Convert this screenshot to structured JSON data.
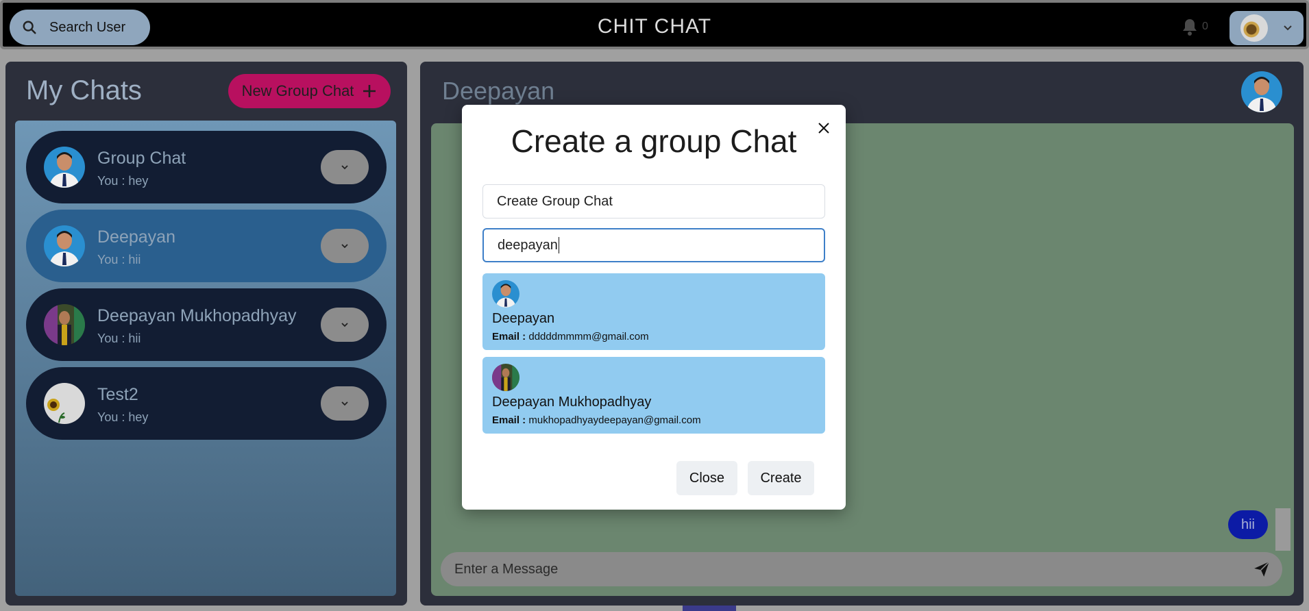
{
  "topbar": {
    "search_label": "Search User",
    "app_title": "CHIT CHAT",
    "notification_count": "0"
  },
  "sidebar": {
    "title": "My Chats",
    "new_group_label": "New Group Chat",
    "chats": [
      {
        "name": "Group Chat",
        "last_message": "You : hey",
        "active": false
      },
      {
        "name": "Deepayan",
        "last_message": "You : hii",
        "active": true
      },
      {
        "name": "Deepayan Mukhopadhyay",
        "last_message": "You : hii",
        "active": false
      },
      {
        "name": "Test2",
        "last_message": "You : hey",
        "active": false
      }
    ]
  },
  "chat": {
    "title": "Deepayan",
    "messages": [
      {
        "text": "hii",
        "from": "me"
      }
    ],
    "input_placeholder": "Enter a Message"
  },
  "modal": {
    "title": "Create a group Chat",
    "group_name_value": "Create Group Chat",
    "search_value": "deepayan",
    "results": [
      {
        "name": "Deepayan",
        "email_label": "Email :",
        "email": "dddddmmmm@gmail.com"
      },
      {
        "name": "Deepayan Mukhopadhyay",
        "email_label": "Email :",
        "email": "mukhopadhyaydeepayan@gmail.com"
      }
    ],
    "close_label": "Close",
    "create_label": "Create"
  },
  "colors": {
    "topbar": "#000000",
    "accent_pink": "#b8105f",
    "active_chat": "#2a5f8e",
    "card_blue": "#91cbf0",
    "bubble": "#0c1ba5"
  },
  "icons": {
    "search": "search-icon",
    "bell": "bell-icon",
    "chevron": "chevron-down-icon",
    "plus": "plus-icon",
    "close": "close-icon",
    "send": "send-icon"
  }
}
